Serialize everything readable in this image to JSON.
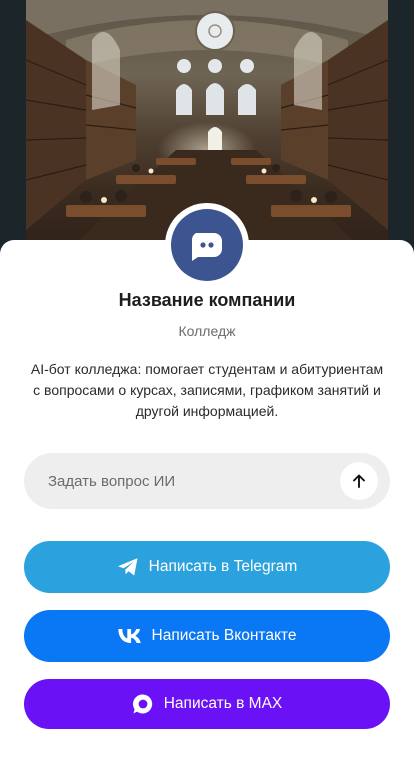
{
  "company": {
    "name": "Название компании",
    "category": "Колледж",
    "description": "AI-бот колледжа: помогает студентам и абитуриентам с вопросами о курсах, записями, графиком занятий и другой информацией."
  },
  "ask": {
    "placeholder": "Задать вопрос ИИ",
    "value": ""
  },
  "actions": {
    "telegram": "Написать в Telegram",
    "vk": "Написать Вконтакте",
    "max": "Написать в MAX"
  },
  "colors": {
    "avatar": "#3c5591",
    "telegram": "#2ba2dd",
    "vk": "#0a77f5",
    "max": "#6a11f5"
  },
  "icons": {
    "avatar": "chat-bot-icon",
    "send": "arrow-up-icon",
    "telegram": "telegram-icon",
    "vk": "vk-icon",
    "max": "max-icon"
  }
}
